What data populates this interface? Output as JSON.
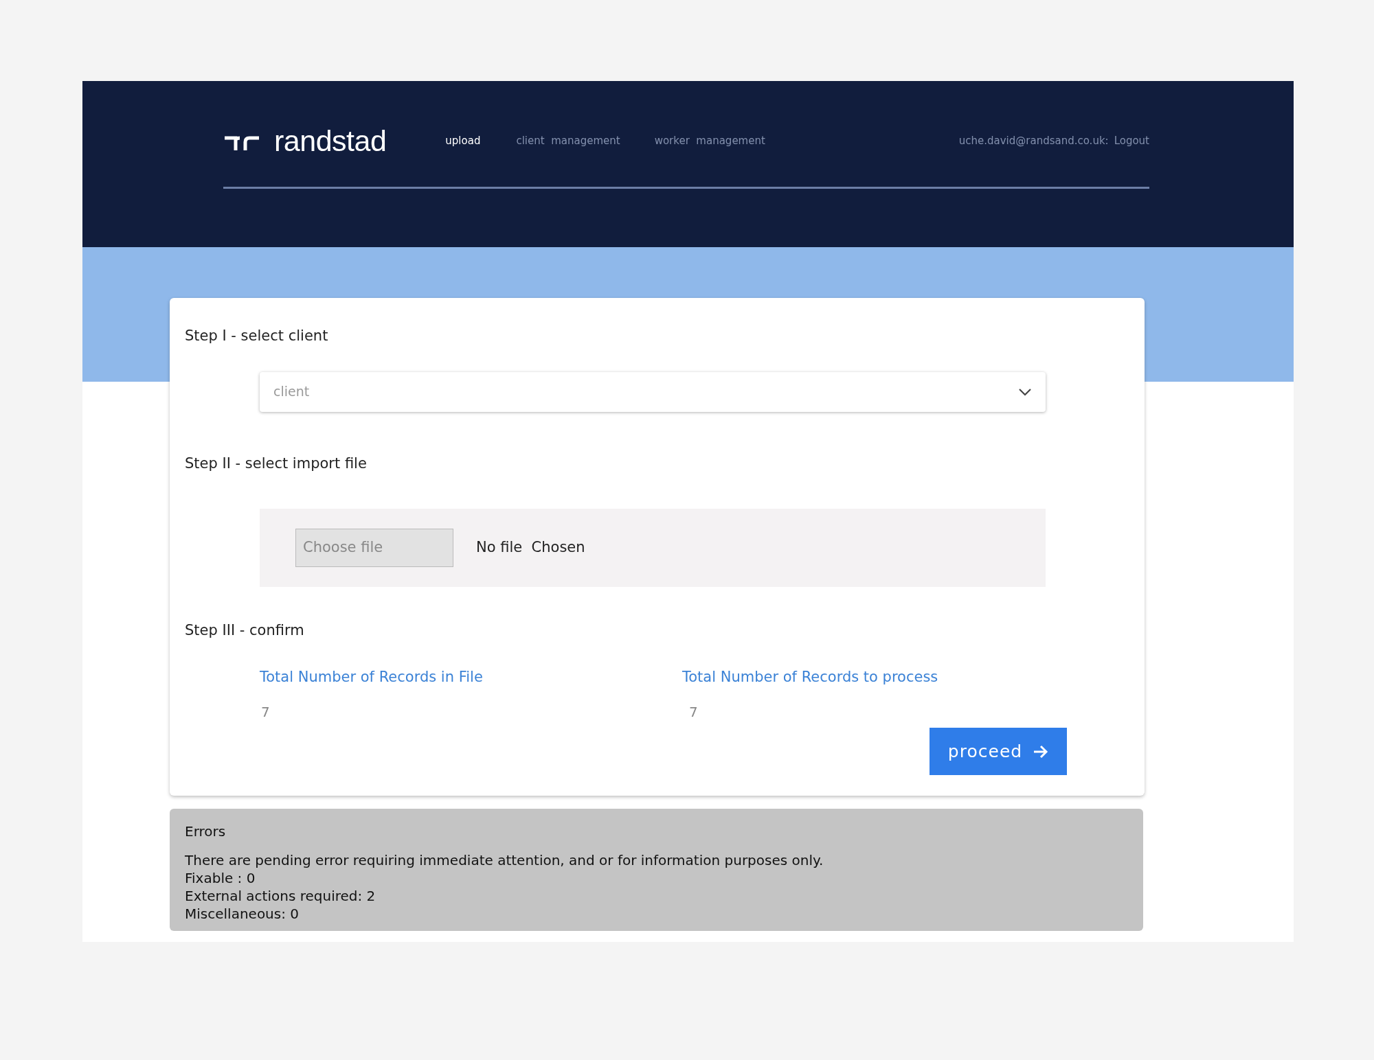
{
  "header": {
    "logo": "randstad",
    "nav": [
      {
        "label": "upload",
        "selected": true
      },
      {
        "label": "client  management",
        "selected": false
      },
      {
        "label": "worker  management",
        "selected": false
      }
    ],
    "user_email": "uche.david@randsand.co.uk:",
    "logout": "Logout"
  },
  "steps": {
    "client": {
      "title": "Step I - select client",
      "placeholder": "client"
    },
    "file": {
      "title": "Step II - select import file",
      "button": "Choose file",
      "status": "No file  Chosen"
    },
    "confirm": {
      "title": "Step III - confirm",
      "stats": [
        {
          "label": "Total Number of Records in File",
          "value": "7"
        },
        {
          "label": "Total Number of Records to process",
          "value": "7"
        }
      ],
      "button": "proceed"
    }
  },
  "errors": {
    "title": "Errors",
    "lines": [
      "There are pending error requiring immediate attention, and or for information purposes only.",
      "Fixable : 0",
      "External actions required: 2",
      "Miscellaneous: 0"
    ]
  }
}
